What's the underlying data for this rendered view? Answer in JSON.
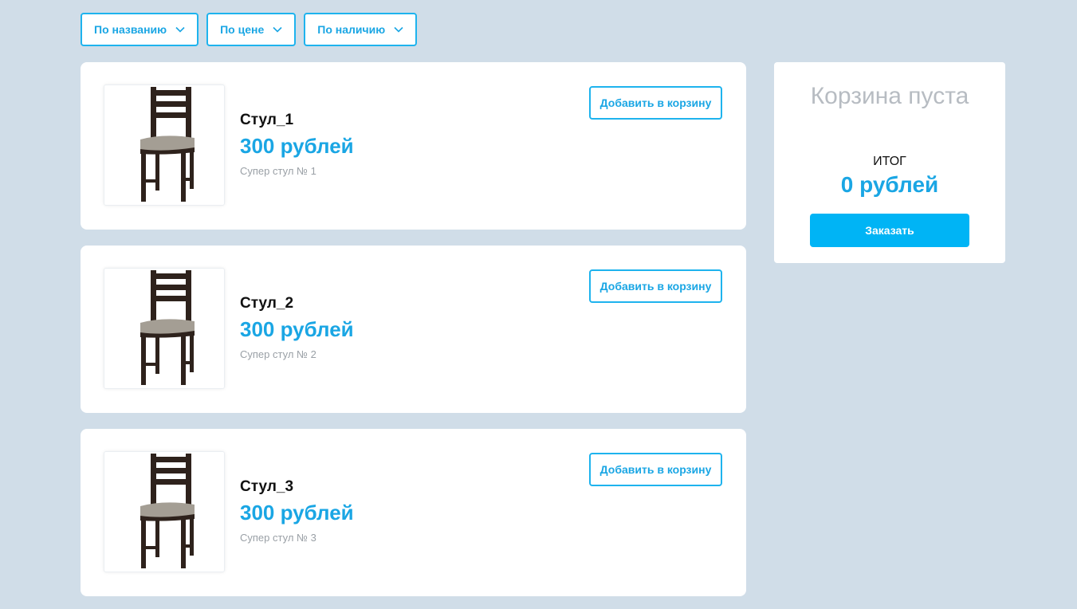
{
  "filters": [
    {
      "label": "По названию",
      "icon": "chevron-down-icon"
    },
    {
      "label": "По цене",
      "icon": "chevron-down-icon"
    },
    {
      "label": "По наличию",
      "icon": "chevron-down-icon"
    }
  ],
  "products": [
    {
      "name": "Стул_1",
      "price": "300 рублей",
      "description": "Супер стул № 1",
      "add_label": "Добавить в корзину",
      "image": "chair-image"
    },
    {
      "name": "Стул_2",
      "price": "300 рублей",
      "description": "Супер стул № 2",
      "add_label": "Добавить в корзину",
      "image": "chair-image"
    },
    {
      "name": "Стул_3",
      "price": "300 рублей",
      "description": "Супер стул № 3",
      "add_label": "Добавить в корзину",
      "image": "chair-image"
    }
  ],
  "cart": {
    "empty_text": "Корзина пуста",
    "total_label": "ИТОГ",
    "total_value": "0 рублей",
    "order_label": "Заказать"
  },
  "colors": {
    "background": "#d0dde8",
    "accent": "#1aa6e4",
    "button_fill": "#00b4f5"
  }
}
